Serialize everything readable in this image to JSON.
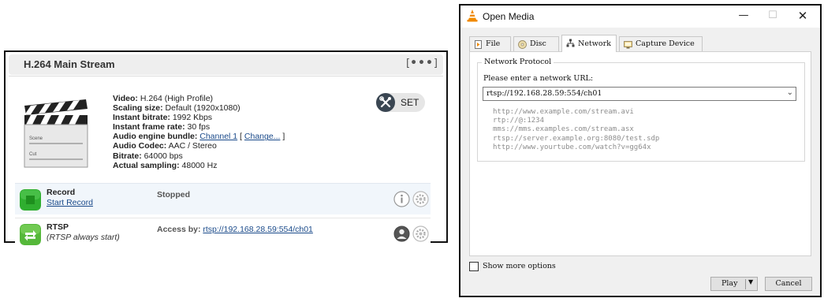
{
  "stream_panel": {
    "title": "H.264 Main Stream",
    "menu_left": "[",
    "menu_dots": "•••",
    "menu_right": "]",
    "clapper_labels": {
      "scene": "Scene",
      "cut": "Cut"
    },
    "info": {
      "video_label": "Video:",
      "video_value": " H.264 (High Profile)",
      "scaling_label": "Scaling size:",
      "scaling_value": " Default (1920x1080)",
      "bitrate_label": "Instant bitrate:",
      "bitrate_value": " 1992 Kbps",
      "framerate_label": "Instant frame rate:",
      "framerate_value": " 30 fps",
      "bundle_label": "Audio engine bundle:",
      "bundle_link": "Channel 1",
      "bundle_open": " [ ",
      "bundle_change": "Change...",
      "bundle_close": " ]",
      "codec_label": "Audio Codec:",
      "codec_value": " AAC / Stereo",
      "audio_bitrate_label": "Bitrate:",
      "audio_bitrate_value": " 64000 bps",
      "sampling_label": "Actual sampling:",
      "sampling_value": " 48000 Hz"
    },
    "set_button": "SET",
    "record": {
      "title": "Record",
      "link": "Start Record",
      "status": "Stopped"
    },
    "rtsp": {
      "title": "RTSP",
      "note": "(RTSP always start)",
      "access_label": "Access by:",
      "access_url": "rtsp://192.168.28.59:554/ch01"
    }
  },
  "dialog": {
    "title": "Open Media",
    "controls": {
      "minimize": "—",
      "maximize": "☐",
      "close": "✕"
    },
    "tabs": [
      {
        "label": "File",
        "active": false
      },
      {
        "label": "Disc",
        "active": false
      },
      {
        "label": "Network",
        "active": true
      },
      {
        "label": "Capture Device",
        "active": false
      }
    ],
    "group_legend": "Network Protocol",
    "url_label": "Please enter a network URL:",
    "url_value": "rtsp://192.168.28.59:554/ch01",
    "examples": [
      "http://www.example.com/stream.avi",
      "rtp://@:1234",
      "mms://mms.examples.com/stream.asx",
      "rtsp://server.example.org:8080/test.sdp",
      "http://www.yourtube.com/watch?v=gg64x"
    ],
    "more_options": "Show more options",
    "play": "Play",
    "cancel": "Cancel"
  },
  "colors": {
    "record_green": "#2fae2f",
    "rtsp_green": "#55b83a",
    "link_blue": "#1a4a8a",
    "vlc_orange": "#f08a00"
  },
  "icons": [
    "clapperboard-icon",
    "tools-icon",
    "record-icon",
    "rtsp-icon",
    "info-icon",
    "gear-icon",
    "user-icon",
    "vlc-cone-icon",
    "file-icon",
    "disc-icon",
    "network-icon",
    "capture-icon"
  ]
}
